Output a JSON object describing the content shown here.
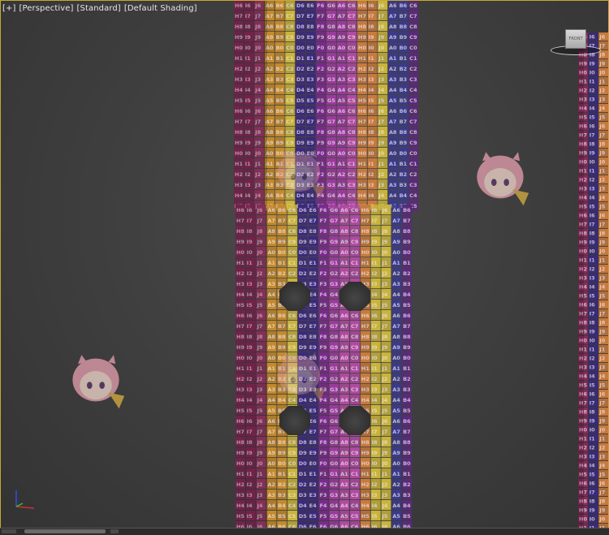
{
  "viewport": {
    "label_parts": [
      "[+]",
      "[Perspective]",
      "[Standard]",
      "[Default Shading]"
    ],
    "border_color": "#c8a830",
    "background_color": "#3f3f3f"
  },
  "viewcube": {
    "face_label": "FRONT",
    "icon": "viewcube-icon"
  },
  "axis_gizmo": {
    "icon": "axis-tripod-icon",
    "colors": {
      "x": "#d03030",
      "y": "#30c030",
      "z": "#3050e0"
    }
  },
  "uv_checker": {
    "column_colors": [
      "#8b2a5a",
      "#a23a6a",
      "#c48a2a",
      "#c9b43a",
      "#3a2a7a",
      "#7a2a8a",
      "#9a3a9a",
      "#b04aa0",
      "#c87a3a",
      "#c9b43a",
      "#3a3a8a",
      "#5a2a7a"
    ],
    "column_letters": [
      "H",
      "I",
      "J",
      "A",
      "B",
      "C",
      "D",
      "E",
      "F",
      "G",
      "A",
      "C"
    ],
    "row_numbers": [
      "6",
      "7",
      "8",
      "9",
      "0",
      "1",
      "2",
      "3",
      "4",
      "5"
    ]
  },
  "decals": {
    "character_icon": "chibi-character-icon"
  }
}
